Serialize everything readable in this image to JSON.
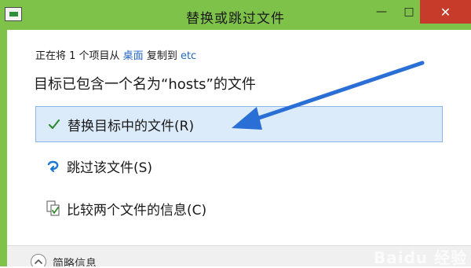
{
  "window": {
    "title": "替换或跳过文件",
    "minimize_glyph": "—",
    "maximize_glyph": "□",
    "close_glyph": "✕",
    "border_color": "#7ec24a",
    "close_color": "#c73b2b"
  },
  "status": {
    "prefix": "正在将 1 个项目从 ",
    "source": "桌面",
    "middle": " 复制到 ",
    "destination": "etc"
  },
  "headline": "目标已包含一个名为“hosts”的文件",
  "options": {
    "replace": {
      "label": "替换目标中的文件(R)",
      "icon": "check-icon",
      "selected": true
    },
    "skip": {
      "label": "跳过该文件(S)",
      "icon": "skip-arrow-icon"
    },
    "compare": {
      "label": "比较两个文件的信息(C)",
      "icon": "compare-files-icon"
    }
  },
  "details": {
    "label": "简略信息",
    "icon": "chevron-up-icon"
  },
  "watermark": {
    "text": "Baidu 经验"
  },
  "colors": {
    "accent": "#2166c3",
    "selected_bg": "#dcebfa",
    "annotation_arrow": "#2a6fd6"
  }
}
